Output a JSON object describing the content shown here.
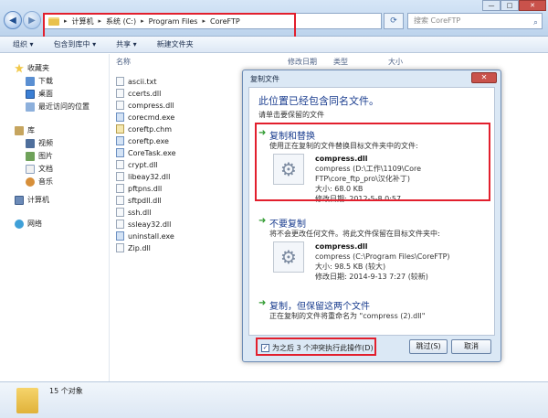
{
  "address": {
    "crumbs": [
      "计算机",
      "系统 (C:)",
      "Program Files",
      "CoreFTP"
    ],
    "search_placeholder": "搜索 CoreFTP"
  },
  "toolbar": {
    "organize": "组织 ▾",
    "include": "包含到库中 ▾",
    "share": "共享 ▾",
    "new_folder": "新建文件夹"
  },
  "nav": {
    "favorites": "收藏夹",
    "downloads": "下载",
    "desktop": "桌面",
    "recent": "最近访问的位置",
    "libraries": "库",
    "videos": "视频",
    "pictures": "图片",
    "documents": "文档",
    "music": "音乐",
    "computer": "计算机",
    "network": "网络"
  },
  "columns": {
    "name": "名称",
    "date": "修改日期",
    "type": "类型",
    "size": "大小"
  },
  "files": [
    "ascii.txt",
    "ccerts.dll",
    "compress.dll",
    "corecmd.exe",
    "coreftp.chm",
    "coreftp.exe",
    "CoreTask.exe",
    "crypt.dll",
    "libeay32.dll",
    "pftpns.dll",
    "sftpdll.dll",
    "ssh.dll",
    "ssleay32.dll",
    "uninstall.exe",
    "Zip.dll"
  ],
  "status": {
    "count": "15 个对象"
  },
  "dialog": {
    "title": "复制文件",
    "heading": "此位置已经包含同名文件。",
    "subheading": "请单击要保留的文件",
    "option1": {
      "title": "复制和替换",
      "desc": "使用正在复制的文件替换目标文件夹中的文件:",
      "file": "compress.dll",
      "path": "compress (D:\\工作\\1109\\Core FTP\\core_ftp_pro\\汉化补丁)",
      "size": "大小: 68.0 KB",
      "date": "修改日期: 2012-5-8 0:57"
    },
    "option2": {
      "title": "不要复制",
      "desc": "将不会更改任何文件。将此文件保留在目标文件夹中:",
      "file": "compress.dll",
      "path": "compress (C:\\Program Files\\CoreFTP)",
      "size": "大小: 98.5 KB (较大)",
      "date": "修改日期: 2014-9-13 7:27 (较新)"
    },
    "option3": {
      "title": "复制，但保留这两个文件",
      "desc": "正在复制的文件将重命名为 \"compress (2).dll\""
    },
    "checkbox_label": "为之后 3 个冲突执行此操作(D)",
    "skip": "跳过(S)",
    "cancel": "取消"
  }
}
